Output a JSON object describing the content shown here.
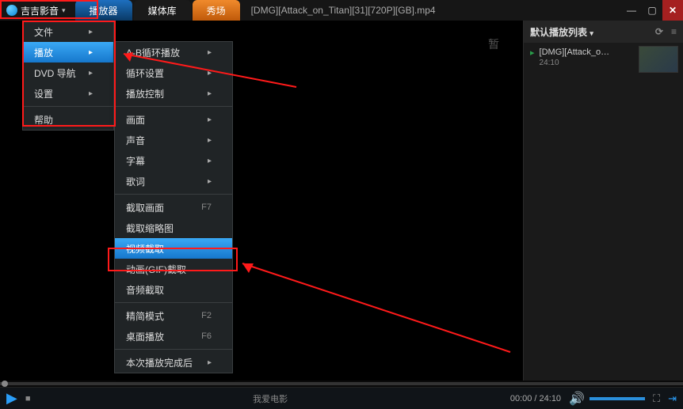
{
  "app": {
    "name": "吉吉影音"
  },
  "tabs": [
    "播放器",
    "媒体库",
    "秀场"
  ],
  "currentFile": "[DMG][Attack_on_Titan][31][720P][GB].mp4",
  "playlist": {
    "title": "默认播放列表",
    "items": [
      {
        "name": "[DMG][Attack_o…",
        "duration": "24:10"
      }
    ]
  },
  "menu1": {
    "items": [
      {
        "label": "文件",
        "sub": true
      },
      {
        "label": "播放",
        "sub": true,
        "active": true
      },
      {
        "label": "DVD 导航",
        "sub": true
      },
      {
        "label": "设置",
        "sub": true
      },
      {
        "label": "帮助"
      }
    ]
  },
  "menu2": {
    "groups": [
      [
        {
          "label": "A-B循环播放",
          "sub": true
        },
        {
          "label": "循环设置",
          "sub": true
        },
        {
          "label": "播放控制",
          "sub": true
        }
      ],
      [
        {
          "label": "画面",
          "sub": true
        },
        {
          "label": "声音",
          "sub": true
        },
        {
          "label": "字幕",
          "sub": true
        },
        {
          "label": "歌词",
          "sub": true
        }
      ],
      [
        {
          "label": "截取画面",
          "shortcut": "F7"
        },
        {
          "label": "截取缩略图"
        },
        {
          "label": "视频截取",
          "highlight": true
        },
        {
          "label": "动画(GIF)截取"
        },
        {
          "label": "音频截取"
        }
      ],
      [
        {
          "label": "精简模式",
          "shortcut": "F2"
        },
        {
          "label": "桌面播放",
          "shortcut": "F6"
        }
      ],
      [
        {
          "label": "本次播放完成后",
          "sub": true
        }
      ]
    ]
  },
  "controls": {
    "centerText": "我爱电影",
    "time": "00:00 / 24:10"
  },
  "videoArea": {
    "placeholder": "暂"
  }
}
